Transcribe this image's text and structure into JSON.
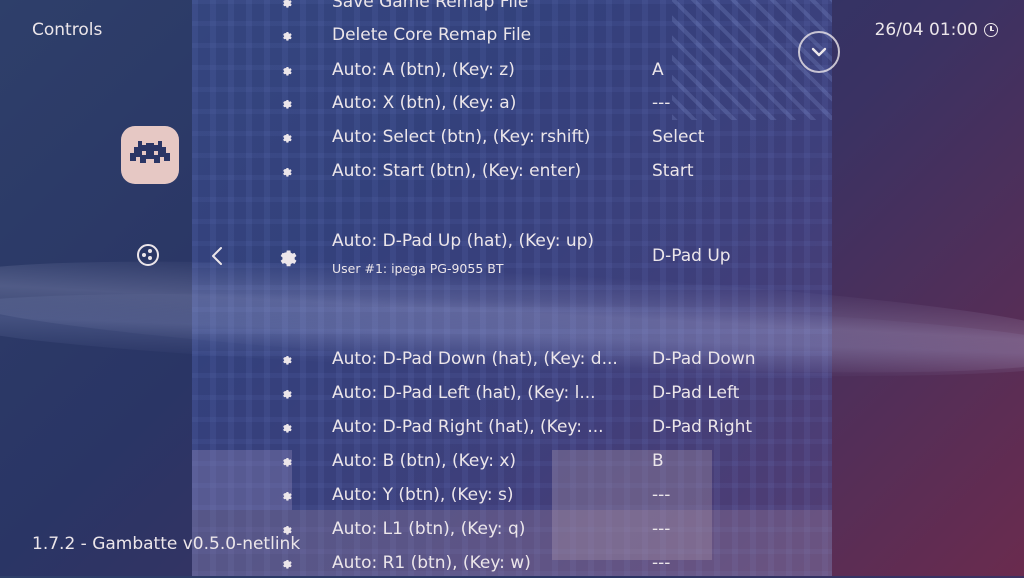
{
  "header": {
    "title": "Controls",
    "datetime": "26/04 01:00"
  },
  "footer": {
    "version": "1.7.2 - Gambatte v0.5.0-netlink"
  },
  "menu": {
    "items": [
      {
        "label": "Save Game Remap File",
        "value": ""
      },
      {
        "label": "Delete Core Remap File",
        "value": ""
      },
      {
        "label": "Auto: A (btn), (Key: z)",
        "value": "A"
      },
      {
        "label": "Auto: X (btn), (Key: a)",
        "value": "---"
      },
      {
        "label": "Auto: Select (btn), (Key: rshift)",
        "value": "Select"
      },
      {
        "label": "Auto: Start (btn), (Key: enter)",
        "value": "Start"
      },
      {
        "label": "Auto:  D-Pad Up (hat), (Key: up)",
        "value": "D-Pad Up",
        "sublabel": "User #1: ipega PG-9055 BT"
      },
      {
        "label": "Auto:  D-Pad Down (hat), (Key: d...",
        "value": "D-Pad Down"
      },
      {
        "label": "Auto:  D-Pad Left (hat), (Key: l...",
        "value": "D-Pad Left"
      },
      {
        "label": "Auto:  D-Pad Right (hat), (Key: ...",
        "value": "D-Pad Right"
      },
      {
        "label": "Auto: B (btn), (Key: x)",
        "value": "B"
      },
      {
        "label": "Auto: Y (btn), (Key: s)",
        "value": "---"
      },
      {
        "label": "Auto: L1 (btn), (Key: q)",
        "value": "---"
      },
      {
        "label": "Auto: R1 (btn), (Key: w)",
        "value": "---"
      }
    ]
  },
  "icons": {
    "app": "retroarch-invader-icon",
    "side": "netplay-icon",
    "back": "back-arrow-icon",
    "scroll": "scroll-down-icon",
    "item": "gear-icon",
    "clock": "clock-icon"
  },
  "colors": {
    "text": "#ece6ea",
    "app_icon_bg": "#e6c8c4",
    "invader": "#2a3565"
  }
}
